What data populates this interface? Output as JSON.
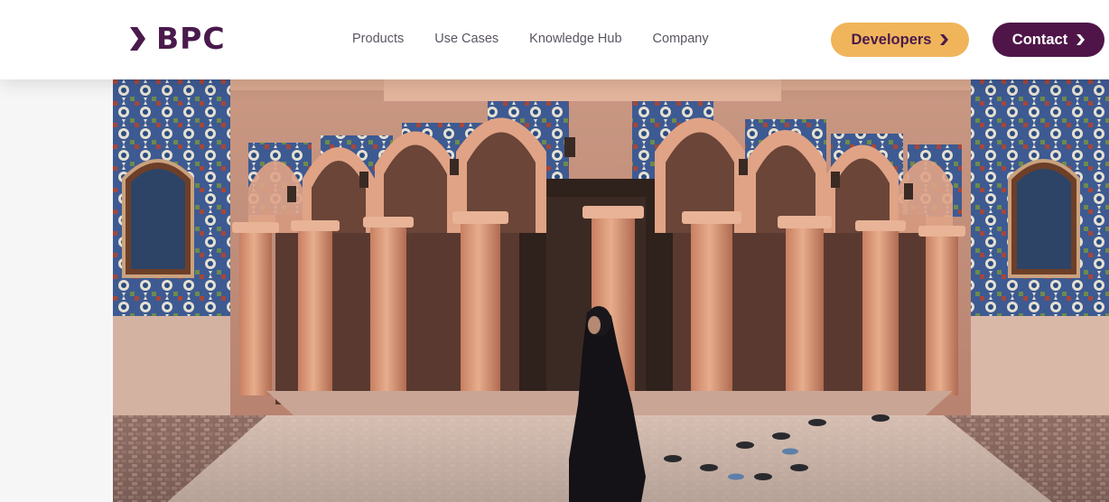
{
  "header": {
    "logo_text": "BPC",
    "nav": [
      "Products",
      "Use Cases",
      "Knowledge Hub",
      "Company"
    ],
    "developers_label": "Developers",
    "contact_label": "Contact"
  },
  "colors": {
    "brand_purple": "#4f1548",
    "accent_orange": "#f0b55a",
    "nav_text": "#5b5461"
  },
  "icons": {
    "logo_chevron": "chevron-right-icon",
    "button_chevron": "chevron-right-icon"
  },
  "hero": {
    "image_description_icon": "mosque-photo"
  }
}
